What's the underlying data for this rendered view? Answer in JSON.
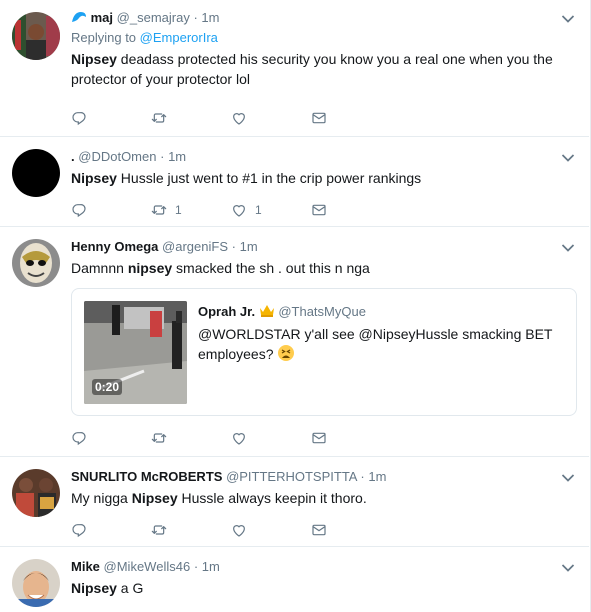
{
  "tweets": [
    {
      "name": "maj",
      "handle": "@_semajray",
      "dot": "·",
      "time": "1m",
      "replying_prefix": "Replying to",
      "replying_handle": "@EmperorIra",
      "bold": "Nipsey",
      "text": " deadass protected his security you know you a real one when you the protector of your protector lol",
      "retweets": "",
      "likes": ""
    },
    {
      "name": ".",
      "handle": "@DDotOmen",
      "dot": "·",
      "time": "1m",
      "bold": "Nipsey",
      "text": " Hussle just went to #1 in the crip power rankings",
      "retweets": "1",
      "likes": "1"
    },
    {
      "name": "Henny Omega",
      "handle": "@argeniFS",
      "dot": "·",
      "time": "1m",
      "text_before": "Damnnn ",
      "bold": "nipsey",
      "text_after": " smacked the sh  . out this n  nga",
      "quote": {
        "name": "Oprah Jr.",
        "handle": "@ThatsMyQue",
        "text": "@WORLDSTAR y'all see @NipseyHussle smacking BET employees?",
        "duration": "0:20"
      },
      "retweets": "",
      "likes": ""
    },
    {
      "name": "SNURLITO McROBERTS",
      "handle": "@PITTERHOTSPITTA",
      "dot": "·",
      "time": "1m",
      "text_before": "My nigga ",
      "bold": "Nipsey",
      "text_after": " Hussle always keepin it thoro.",
      "retweets": "",
      "likes": ""
    },
    {
      "name": "Mike",
      "handle": "@MikeWells46",
      "dot": "·",
      "time": "1m",
      "bold": "Nipsey",
      "text": " a G"
    }
  ],
  "icons": {
    "reply": "reply-icon",
    "retweet": "retweet-icon",
    "like": "heart-icon",
    "dm": "envelope-icon",
    "caret": "chevron-down-icon"
  },
  "colors": {
    "accent": "#1da1f2",
    "muted": "#657786",
    "text": "#14171a",
    "border": "#e6ecf0"
  }
}
